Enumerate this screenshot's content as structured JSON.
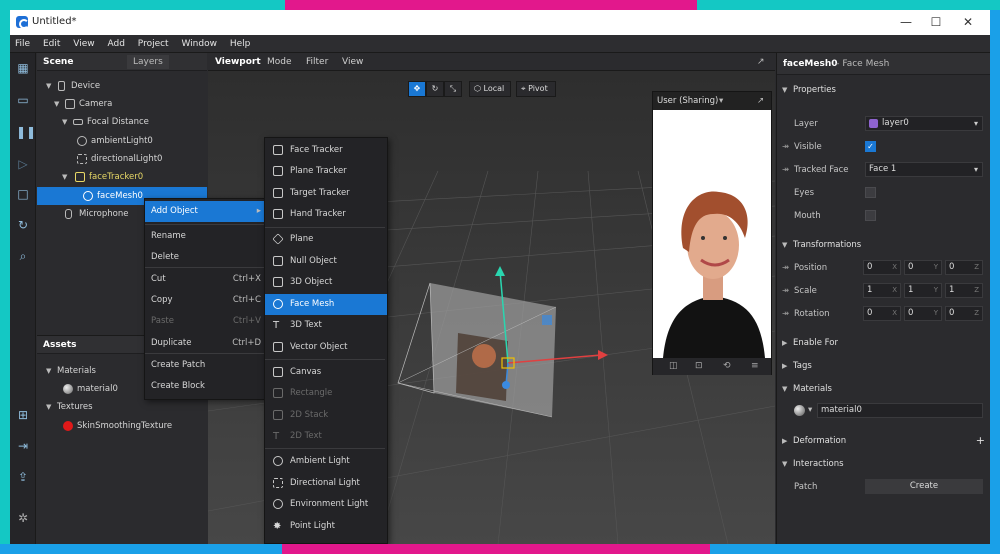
{
  "window": {
    "title": "Untitled*",
    "minimize": "—",
    "maximize": "☐",
    "close": "✕"
  },
  "menu": [
    "File",
    "Edit",
    "View",
    "Add",
    "Project",
    "Window",
    "Help"
  ],
  "scene_panel": {
    "tab_scene": "Scene",
    "tab_layers": "Layers",
    "tree": [
      {
        "label": "Device",
        "icon": "device-icon"
      },
      {
        "label": "Camera",
        "icon": "camera-icon"
      },
      {
        "label": "Focal Distance",
        "icon": "focal-distance-icon"
      },
      {
        "label": "ambientLight0",
        "icon": "ambient-light-icon"
      },
      {
        "label": "directionalLight0",
        "icon": "directional-light-icon"
      },
      {
        "label": "faceTracker0",
        "icon": "face-tracker-icon"
      },
      {
        "label": "faceMesh0",
        "icon": "face-mesh-icon",
        "selected": true
      },
      {
        "label": "Microphone",
        "icon": "microphone-icon"
      }
    ]
  },
  "assets_panel": {
    "title": "Assets",
    "materials_label": "Materials",
    "material_item": "material0",
    "textures_label": "Textures",
    "texture_item": "SkinSmoothingTexture",
    "texture_color": "#e01919"
  },
  "viewport": {
    "tab_viewport": "Viewport",
    "tab_mode": "Mode",
    "tab_filter": "Filter",
    "tab_view": "View",
    "local_label": "Local",
    "pivot_label": "Pivot"
  },
  "simulator": {
    "title": "User (Sharing)"
  },
  "context_menu": [
    {
      "label": "Add Object",
      "shortcut": "▸",
      "highlighted": true
    },
    {
      "label": "Rename",
      "shortcut": ""
    },
    {
      "label": "Delete",
      "shortcut": ""
    },
    {
      "label": "Cut",
      "shortcut": "Ctrl+X"
    },
    {
      "label": "Copy",
      "shortcut": "Ctrl+C"
    },
    {
      "label": "Paste",
      "shortcut": "Ctrl+V",
      "disabled": true
    },
    {
      "label": "Duplicate",
      "shortcut": "Ctrl+D"
    },
    {
      "label": "Create Patch",
      "shortcut": ""
    },
    {
      "label": "Create Block",
      "shortcut": ""
    }
  ],
  "add_object_menu": [
    {
      "label": "Face Tracker",
      "icon": "face-tracker-icon"
    },
    {
      "label": "Plane Tracker",
      "icon": "plane-tracker-icon"
    },
    {
      "label": "Target Tracker",
      "icon": "target-tracker-icon"
    },
    {
      "label": "Hand Tracker",
      "icon": "hand-tracker-icon"
    },
    {
      "label": "Plane",
      "icon": "plane-icon"
    },
    {
      "label": "Null Object",
      "icon": "null-object-icon"
    },
    {
      "label": "3D Object",
      "icon": "3d-object-icon"
    },
    {
      "label": "Face Mesh",
      "icon": "face-mesh-icon",
      "highlighted": true
    },
    {
      "label": "3D Text",
      "icon": "3d-text-icon"
    },
    {
      "label": "Vector Object",
      "icon": "vector-object-icon"
    },
    {
      "label": "Canvas",
      "icon": "canvas-icon"
    },
    {
      "label": "Rectangle",
      "icon": "rectangle-icon",
      "disabled": true
    },
    {
      "label": "2D Stack",
      "icon": "2d-stack-icon",
      "disabled": true
    },
    {
      "label": "2D Text",
      "icon": "2d-text-icon",
      "disabled": true
    },
    {
      "label": "Ambient Light",
      "icon": "ambient-light-icon"
    },
    {
      "label": "Directional Light",
      "icon": "directional-light-icon"
    },
    {
      "label": "Environment Light",
      "icon": "environment-light-icon"
    },
    {
      "label": "Point Light",
      "icon": "point-light-icon"
    }
  ],
  "inspector": {
    "object_name": "faceMesh0",
    "object_type": "– Face Mesh",
    "properties_label": "Properties",
    "layer_label": "Layer",
    "layer_value": "layer0",
    "layer_color": "#8e63cf",
    "visible_label": "Visible",
    "visible_checked": true,
    "tracked_face_label": "Tracked Face",
    "tracked_face_value": "Face 1",
    "eyes_label": "Eyes",
    "eyes_checked": false,
    "mouth_label": "Mouth",
    "mouth_checked": false,
    "transformations_label": "Transformations",
    "position_label": "Position",
    "position": [
      "0",
      "0",
      "0"
    ],
    "scale_label": "Scale",
    "scale": [
      "1",
      "1",
      "1"
    ],
    "rotation_label": "Rotation",
    "rotation": [
      "0",
      "0",
      "0"
    ],
    "axes": [
      "X",
      "Y",
      "Z"
    ],
    "enable_for_label": "Enable For",
    "tags_label": "Tags",
    "materials_label": "Materials",
    "material_value": "material0",
    "deformation_label": "Deformation",
    "interactions_label": "Interactions",
    "patch_label": "Patch",
    "create_label": "Create"
  },
  "colors": {
    "accent": "#1a78d4",
    "frame_teal": "#14c8c4",
    "frame_magenta": "#e2188c",
    "frame_blue": "#1aa0e8"
  }
}
